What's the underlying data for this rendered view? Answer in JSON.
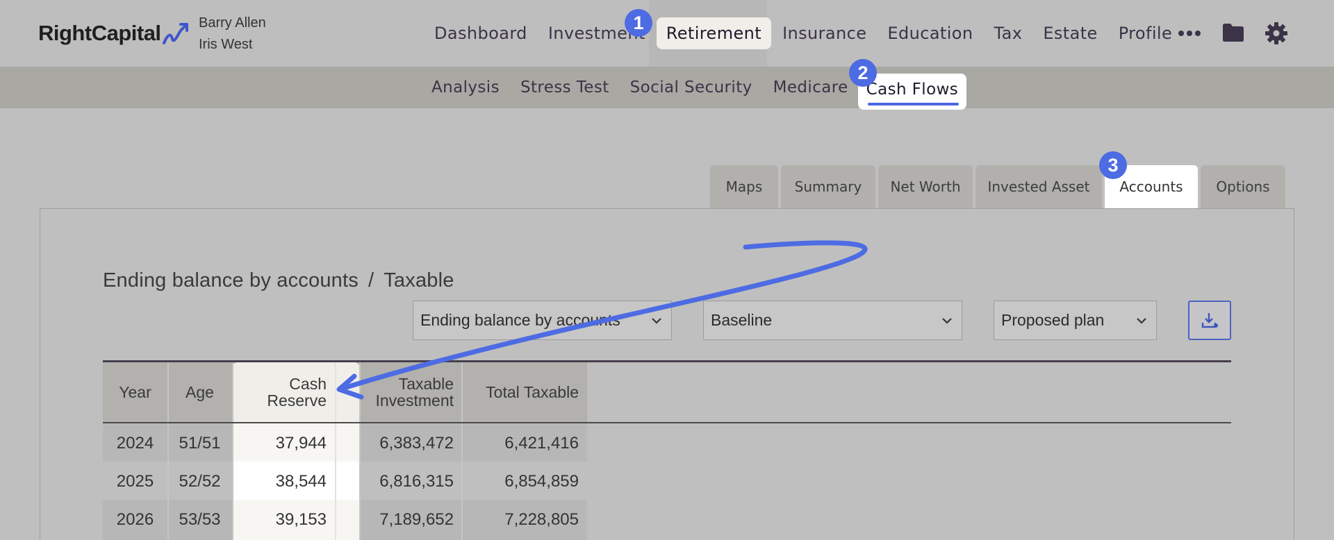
{
  "brand": {
    "name": "RightCapital"
  },
  "clients": {
    "primary": "Barry Allen",
    "secondary": "Iris West"
  },
  "main_nav": {
    "items": [
      "Dashboard",
      "Investment",
      "Retirement",
      "Insurance",
      "Education",
      "Tax",
      "Estate",
      "Profile"
    ],
    "active": "Retirement",
    "more_icon": "more-dots-icon",
    "folder_icon": "folder-icon",
    "settings_icon": "gear-icon"
  },
  "sub_nav": {
    "items": [
      "Analysis",
      "Stress Test",
      "Social Security",
      "Medicare",
      "Cash Flows"
    ],
    "active": "Cash Flows"
  },
  "tabs": {
    "items": [
      "Maps",
      "Summary",
      "Net Worth",
      "Invested Asset",
      "Accounts",
      "Options"
    ],
    "active": "Accounts"
  },
  "badges": [
    "1",
    "2",
    "3"
  ],
  "page": {
    "title_main": "Ending balance by accounts",
    "title_sep": "/",
    "title_sub": "Taxable"
  },
  "controls": {
    "view_select": "Ending balance by accounts",
    "scenario_select": "Baseline",
    "plan_select": "Proposed plan",
    "download_icon": "download-icon"
  },
  "table": {
    "headers": {
      "year": "Year",
      "age": "Age",
      "cash_reserve_1": "Cash",
      "cash_reserve_2": "Reserve",
      "taxable_1": "Taxable",
      "taxable_2": "Investment",
      "total": "Total Taxable"
    },
    "rows": [
      {
        "year": "2024",
        "age": "51/51",
        "cash_reserve": "37,944",
        "taxable_investment": "6,383,472",
        "total_taxable": "6,421,416"
      },
      {
        "year": "2025",
        "age": "52/52",
        "cash_reserve": "38,544",
        "taxable_investment": "6,816,315",
        "total_taxable": "6,854,859"
      },
      {
        "year": "2026",
        "age": "53/53",
        "cash_reserve": "39,153",
        "taxable_investment": "7,189,652",
        "total_taxable": "7,228,805"
      }
    ]
  },
  "colors": {
    "accent": "#4d6be3",
    "highlight_bg": "#f0eee9"
  }
}
